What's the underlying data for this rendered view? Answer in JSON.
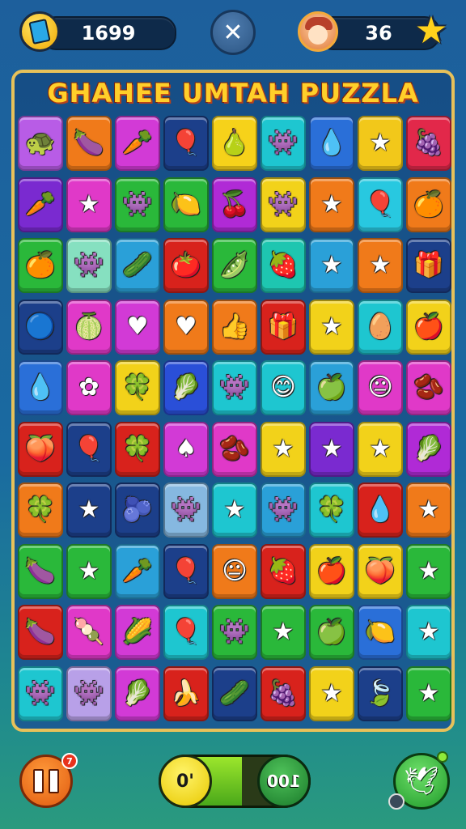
{
  "header": {
    "coins": "1699",
    "close_icon": "✕",
    "stars": "36",
    "star_icon": "★"
  },
  "board": {
    "title": "GHAHEE UMTAH PUZZLA",
    "columns": 9,
    "rows": 10,
    "tiles": [
      [
        "#b85ce6",
        "🐢"
      ],
      [
        "#f07a1a",
        "🍆"
      ],
      [
        "#d23ad6",
        "🥕"
      ],
      [
        "#1c3f8a",
        "🎈"
      ],
      [
        "#f6d21a",
        "🍐"
      ],
      [
        "#1ec6d0",
        "👾"
      ],
      [
        "#2a6fd8",
        "💧"
      ],
      [
        "#f2c81a",
        "★"
      ],
      [
        "#e2284a",
        "🍇"
      ],
      [
        "#7a2ad0",
        "🥕"
      ],
      [
        "#e039c8",
        "★"
      ],
      [
        "#2ab83a",
        "👾"
      ],
      [
        "#2ab83a",
        "🍋"
      ],
      [
        "#b02ad6",
        "🍒"
      ],
      [
        "#f2d21a",
        "👾"
      ],
      [
        "#f07a1a",
        "★"
      ],
      [
        "#28c8e0",
        "🎈"
      ],
      [
        "#f07a1a",
        "🍊"
      ],
      [
        "#2ab83a",
        "🍊"
      ],
      [
        "#86e0c0",
        "👾"
      ],
      [
        "#2aa0d8",
        "🥒"
      ],
      [
        "#d8221c",
        "🍅"
      ],
      [
        "#2ab83a",
        "🫛"
      ],
      [
        "#1ec6b0",
        "🍓"
      ],
      [
        "#2aa0d8",
        "★"
      ],
      [
        "#f07a1a",
        "★"
      ],
      [
        "#1c3f8a",
        "🎁"
      ],
      [
        "#1c3f8a",
        "🔵"
      ],
      [
        "#e039c8",
        "🍈"
      ],
      [
        "#d23ad6",
        "♥"
      ],
      [
        "#f07a1a",
        "♥"
      ],
      [
        "#f07a1a",
        "👍"
      ],
      [
        "#d8221c",
        "🎁"
      ],
      [
        "#f2d21a",
        "★"
      ],
      [
        "#1ec6d0",
        "🥚"
      ],
      [
        "#f2d21a",
        "🍎"
      ],
      [
        "#2a6fd8",
        "💧"
      ],
      [
        "#e039c8",
        "✿"
      ],
      [
        "#f2d21a",
        "🍀"
      ],
      [
        "#2a4fd8",
        "🥬"
      ],
      [
        "#1ec6d0",
        "👾"
      ],
      [
        "#1ec6d0",
        "😊"
      ],
      [
        "#2aa0d8",
        "🍏"
      ],
      [
        "#e039c8",
        "😐"
      ],
      [
        "#e039c8",
        "🫘"
      ],
      [
        "#d8221c",
        "🍑"
      ],
      [
        "#1c3f8a",
        "🎈"
      ],
      [
        "#d8221c",
        "🍀"
      ],
      [
        "#d23ad6",
        "♠"
      ],
      [
        "#e039c8",
        "🫘"
      ],
      [
        "#f2d21a",
        "★"
      ],
      [
        "#7a2ad0",
        "★"
      ],
      [
        "#f2d21a",
        "★"
      ],
      [
        "#b02ad6",
        "🥬"
      ],
      [
        "#f07a1a",
        "🍀"
      ],
      [
        "#1c3f8a",
        "★"
      ],
      [
        "#1c3f8a",
        "🫐"
      ],
      [
        "#86b8e0",
        "👾"
      ],
      [
        "#1ec6d0",
        "★"
      ],
      [
        "#2aa0d8",
        "👾"
      ],
      [
        "#1ec6d0",
        "🍀"
      ],
      [
        "#d8221c",
        "💧"
      ],
      [
        "#f07a1a",
        "★"
      ],
      [
        "#2ab83a",
        "🍆"
      ],
      [
        "#2ab83a",
        "★"
      ],
      [
        "#2aa0d8",
        "🥕"
      ],
      [
        "#1c3f8a",
        "🎈"
      ],
      [
        "#f07a1a",
        "😐"
      ],
      [
        "#d8221c",
        "🍓"
      ],
      [
        "#f2d21a",
        "🍎"
      ],
      [
        "#f2d21a",
        "🍑"
      ],
      [
        "#2ab83a",
        "★"
      ],
      [
        "#d8221c",
        "🍆"
      ],
      [
        "#e039c8",
        "🍡"
      ],
      [
        "#d23ad6",
        "🌽"
      ],
      [
        "#1ec6d0",
        "🎈"
      ],
      [
        "#2ab83a",
        "👾"
      ],
      [
        "#2ab83a",
        "★"
      ],
      [
        "#2ab83a",
        "🍏"
      ],
      [
        "#2a6fd8",
        "🍋"
      ],
      [
        "#1ec6d0",
        "★"
      ],
      [
        "#1ec6d0",
        "👾"
      ],
      [
        "#b8a0e8",
        "👾"
      ],
      [
        "#d23ad6",
        "🥬"
      ],
      [
        "#d8221c",
        "🍌"
      ],
      [
        "#1c3f8a",
        "🥒"
      ],
      [
        "#d8221c",
        "🍇"
      ],
      [
        "#f2d21a",
        "★"
      ],
      [
        "#1c3f8a",
        "🍃"
      ],
      [
        "#2ab83a",
        "★"
      ]
    ]
  },
  "footer": {
    "pause_icon": "pause-icon",
    "pause_badge": "7",
    "progress_start": "0'",
    "progress_end": "100",
    "progress_fraction": 0.55,
    "hint_icon": "🕊"
  }
}
